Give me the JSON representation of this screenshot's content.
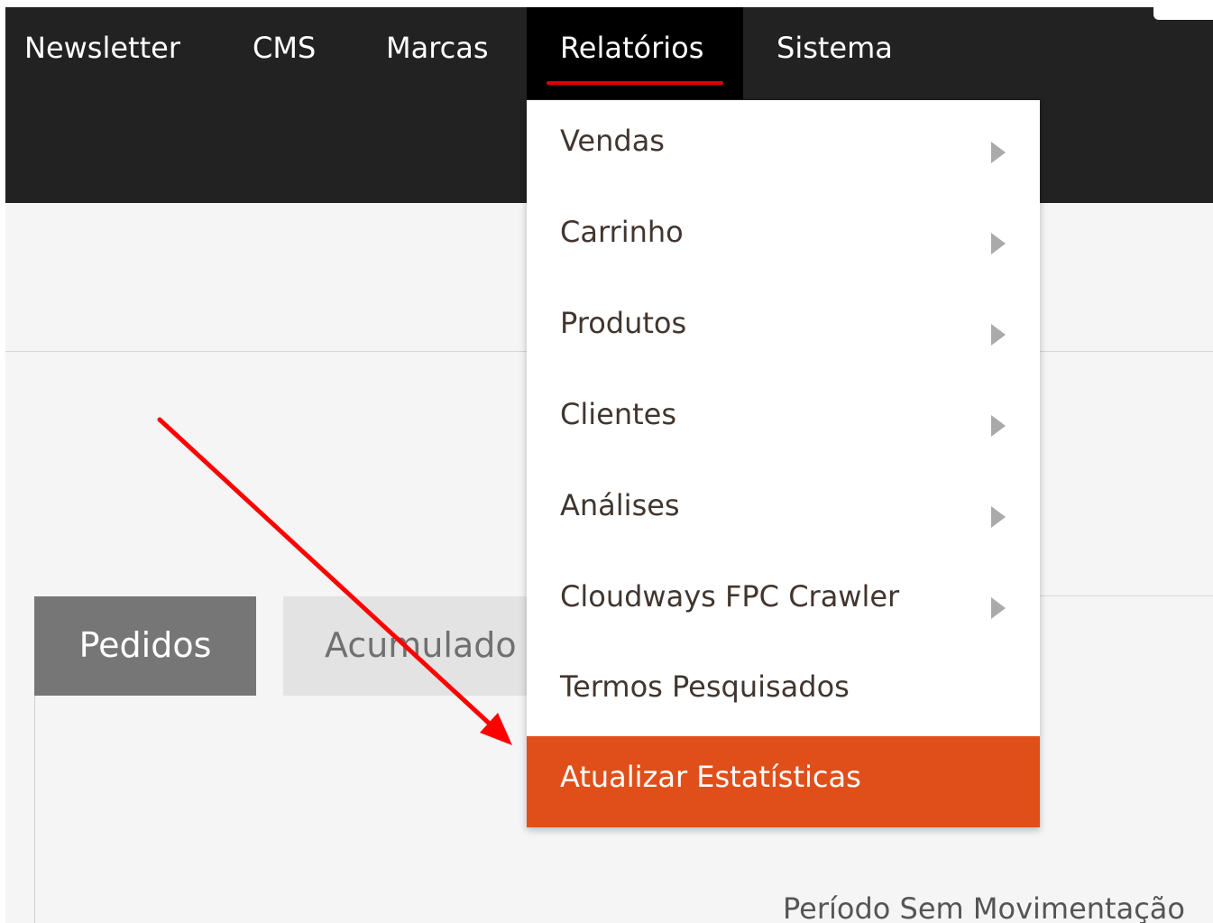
{
  "nav": {
    "items": [
      {
        "label": "Newsletter"
      },
      {
        "label": "CMS"
      },
      {
        "label": "Marcas"
      },
      {
        "label": "Relatórios"
      },
      {
        "label": "Sistema"
      }
    ],
    "active": "Relatórios"
  },
  "dropdown": {
    "items": [
      {
        "label": "Vendas",
        "has_submenu": true
      },
      {
        "label": "Carrinho",
        "has_submenu": true
      },
      {
        "label": "Produtos",
        "has_submenu": true
      },
      {
        "label": "Clientes",
        "has_submenu": true
      },
      {
        "label": "Análises",
        "has_submenu": true
      },
      {
        "label": "Cloudways FPC Crawler",
        "has_submenu": true
      },
      {
        "label": "Termos Pesquisados",
        "has_submenu": false
      },
      {
        "label": "Atualizar Estatísticas",
        "has_submenu": false
      }
    ],
    "highlighted": "Atualizar Estatísticas"
  },
  "tabs": [
    {
      "label": "Pedidos"
    },
    {
      "label": "Acumulado"
    }
  ],
  "main": {
    "periodo_text": "Período Sem Movimentação"
  },
  "colors": {
    "topbar": "#222222",
    "active_nav_bg": "#000000",
    "underline": "#e00000",
    "highlight": "#e04f1a",
    "annotation_arrow": "#ff0000"
  }
}
